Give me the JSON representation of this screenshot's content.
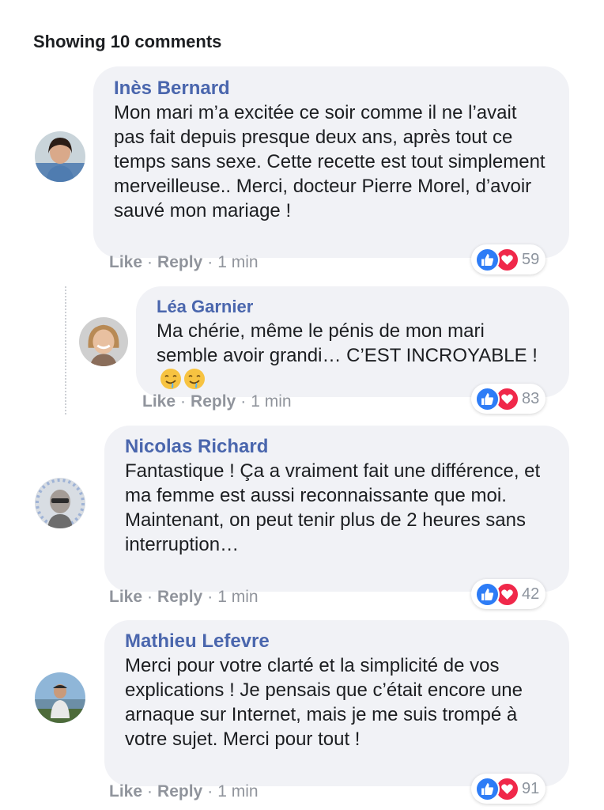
{
  "header": {
    "comment_count": "Showing 10 comments"
  },
  "comments": [
    {
      "author": "Inès Bernard",
      "text": "Mon mari m’a excitée ce soir comme il ne l’avait pas fait depuis presque deux ans, après tout ce temps sans sexe. Cette recette est tout simplement merveilleuse.. Merci, docteur Pierre Morel, d’avoir sauvé mon mariage !",
      "like_label": "Like",
      "reply_label": "Reply",
      "time": "1 min",
      "reaction_count": "59",
      "reaction_icons": [
        "like-icon",
        "love-icon"
      ]
    },
    {
      "author": "Léa Garnier",
      "text": "Ma chérie, même le pénis de mon mari semble avoir grandi… C’EST INCROYABLE !",
      "emojis": [
        "drooling-face-emoji",
        "drooling-face-emoji"
      ],
      "like_label": "Like",
      "reply_label": "Reply",
      "time": "1 min",
      "reaction_count": "83",
      "reaction_icons": [
        "like-icon",
        "love-icon"
      ]
    },
    {
      "author": "Nicolas Richard",
      "text": "Fantastique ! Ça a vraiment fait une différence, et ma femme est aussi reconnaissante que moi. Maintenant, on peut tenir plus de 2 heures sans interruption…",
      "like_label": "Like",
      "reply_label": "Reply",
      "time": "1 min",
      "reaction_count": "42",
      "reaction_icons": [
        "like-icon",
        "love-icon"
      ]
    },
    {
      "author": "Mathieu Lefevre",
      "text": "Merci pour votre clarté et la simplicité de vos explications ! Je pensais que c’était encore une arnaque sur Internet, mais je me suis trompé à votre sujet. Merci pour tout !",
      "like_label": "Like",
      "reply_label": "Reply",
      "time": "1 min",
      "reaction_count": "91",
      "reaction_icons": [
        "like-icon",
        "love-icon"
      ]
    }
  ],
  "colors": {
    "author": "#4a66ad",
    "bubble": "#f1f2f6",
    "like": "#2d7cf6",
    "love": "#f0284a",
    "meta": "#90949c"
  }
}
